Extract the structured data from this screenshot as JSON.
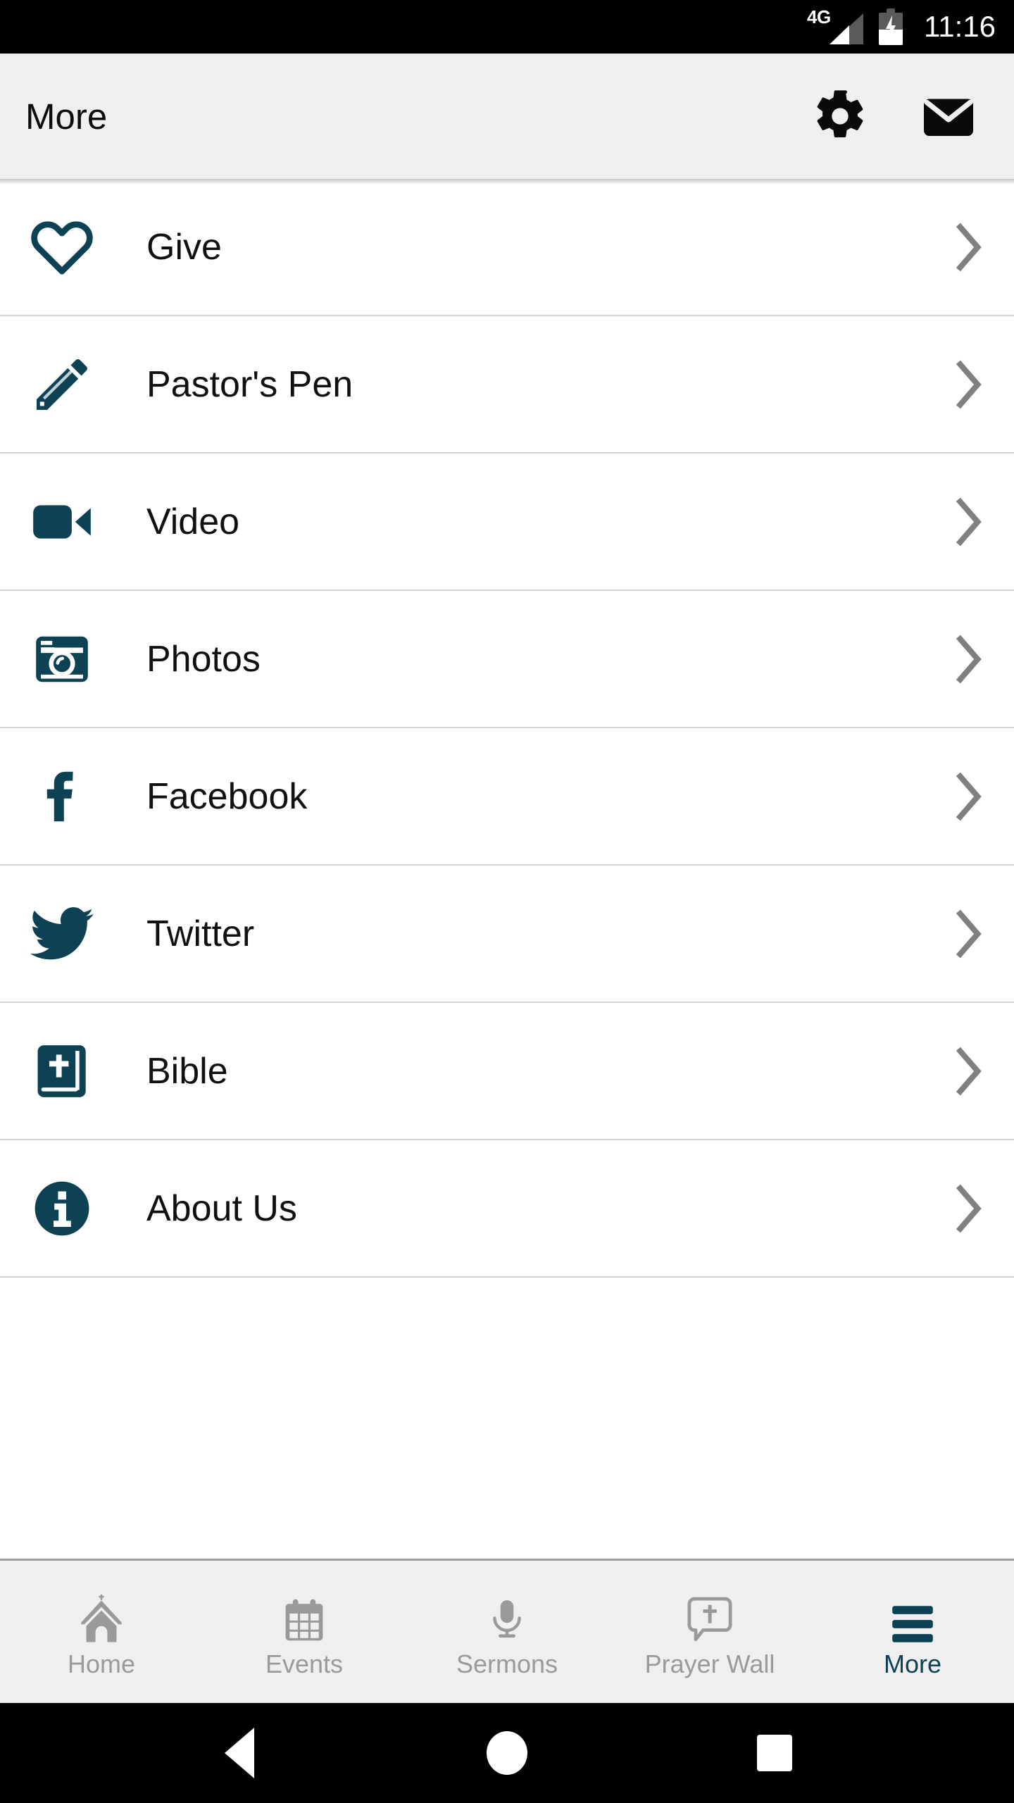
{
  "status_bar": {
    "network_label": "4G",
    "time": "11:16",
    "signal_icon": "signal-bars-icon",
    "battery_icon": "battery-charging-icon"
  },
  "header": {
    "title": "More",
    "background_color": "#efefef",
    "actions": [
      {
        "name": "settings-button",
        "icon": "gear-icon"
      },
      {
        "name": "mail-button",
        "icon": "envelope-icon"
      }
    ]
  },
  "theme": {
    "accent_color": "#0d4254",
    "divider_color": "#d3d3d3",
    "inactive_tab_color": "#9a9a9a",
    "chevron_color": "#808080"
  },
  "list": {
    "chevron_icon": "chevron-right-icon",
    "items": [
      {
        "label": "Give",
        "icon": "heart-outline-icon"
      },
      {
        "label": "Pastor's Pen",
        "icon": "pencil-icon"
      },
      {
        "label": "Video",
        "icon": "video-camera-icon"
      },
      {
        "label": "Photos",
        "icon": "camera-icon"
      },
      {
        "label": "Facebook",
        "icon": "facebook-icon"
      },
      {
        "label": "Twitter",
        "icon": "twitter-bird-icon"
      },
      {
        "label": "Bible",
        "icon": "bible-book-icon"
      },
      {
        "label": "About Us",
        "icon": "info-circle-icon"
      }
    ]
  },
  "tab_bar": {
    "tabs": [
      {
        "label": "Home",
        "icon": "church-icon",
        "active": false
      },
      {
        "label": "Events",
        "icon": "calendar-icon",
        "active": false
      },
      {
        "label": "Sermons",
        "icon": "microphone-icon",
        "active": false
      },
      {
        "label": "Prayer Wall",
        "icon": "speech-cross-icon",
        "active": false
      },
      {
        "label": "More",
        "icon": "hamburger-icon",
        "active": true
      }
    ]
  },
  "android_nav": {
    "back": "back-triangle-icon",
    "home": "home-circle-icon",
    "recents": "recents-square-icon"
  }
}
